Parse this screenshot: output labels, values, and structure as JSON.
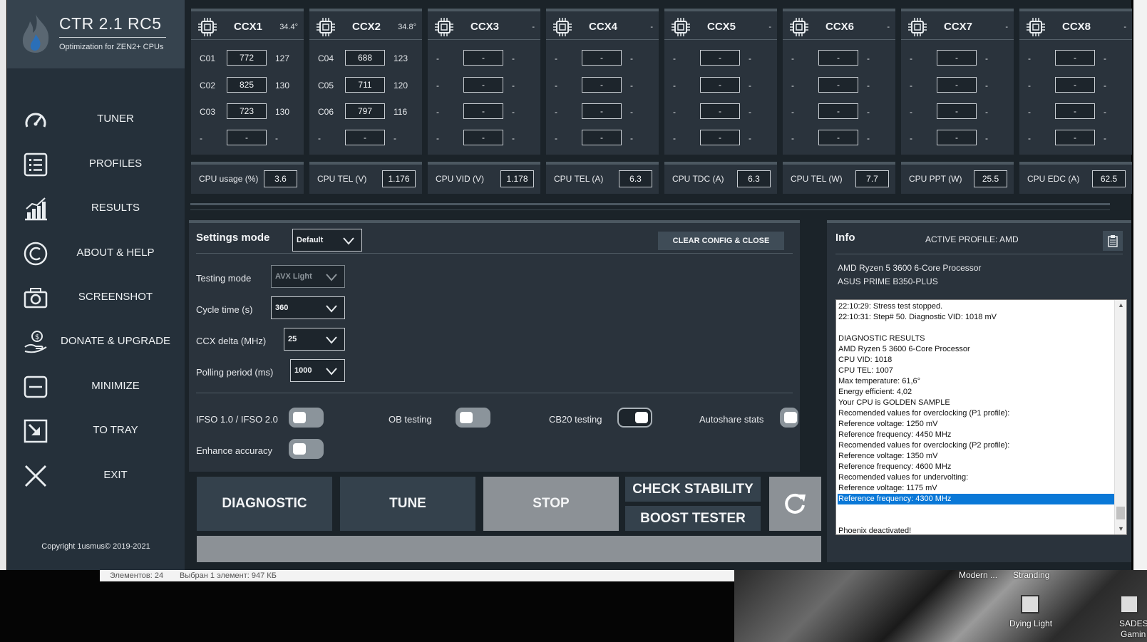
{
  "window": {
    "title": "CTR 2.1 RC5",
    "subtitle": "Optimization for ZEN2+ CPUs",
    "copyright": "Copyright 1usmus© 2019-2021"
  },
  "sidebar": {
    "items": [
      {
        "label": "TUNER",
        "icon": "gauge-icon"
      },
      {
        "label": "PROFILES",
        "icon": "list-icon"
      },
      {
        "label": "RESULTS",
        "icon": "chart-icon"
      },
      {
        "label": "ABOUT & HELP",
        "icon": "copyright-icon"
      },
      {
        "label": "SCREENSHOT",
        "icon": "camera-icon"
      },
      {
        "label": "DONATE & UPGRADE",
        "icon": "donate-hand-icon"
      },
      {
        "label": "MINIMIZE",
        "icon": "minimize-icon"
      },
      {
        "label": "TO TRAY",
        "icon": "tray-icon"
      },
      {
        "label": "EXIT",
        "icon": "close-icon"
      }
    ]
  },
  "ccx": [
    {
      "name": "CCX1",
      "temp": "34.4°",
      "cores": [
        {
          "id": "C01",
          "freq": "772",
          "val": "127"
        },
        {
          "id": "C02",
          "freq": "825",
          "val": "130"
        },
        {
          "id": "C03",
          "freq": "723",
          "val": "130"
        },
        {
          "id": "-",
          "freq": "-",
          "val": "-"
        }
      ]
    },
    {
      "name": "CCX2",
      "temp": "34.8°",
      "cores": [
        {
          "id": "C04",
          "freq": "688",
          "val": "123"
        },
        {
          "id": "C05",
          "freq": "711",
          "val": "120"
        },
        {
          "id": "C06",
          "freq": "797",
          "val": "116"
        },
        {
          "id": "-",
          "freq": "-",
          "val": "-"
        }
      ]
    },
    {
      "name": "CCX3",
      "temp": "-",
      "cores": [
        {
          "id": "-",
          "freq": "-",
          "val": "-"
        },
        {
          "id": "-",
          "freq": "-",
          "val": "-"
        },
        {
          "id": "-",
          "freq": "-",
          "val": "-"
        },
        {
          "id": "-",
          "freq": "-",
          "val": "-"
        }
      ]
    },
    {
      "name": "CCX4",
      "temp": "-",
      "cores": [
        {
          "id": "-",
          "freq": "-",
          "val": "-"
        },
        {
          "id": "-",
          "freq": "-",
          "val": "-"
        },
        {
          "id": "-",
          "freq": "-",
          "val": "-"
        },
        {
          "id": "-",
          "freq": "-",
          "val": "-"
        }
      ]
    },
    {
      "name": "CCX5",
      "temp": "-",
      "cores": [
        {
          "id": "-",
          "freq": "-",
          "val": "-"
        },
        {
          "id": "-",
          "freq": "-",
          "val": "-"
        },
        {
          "id": "-",
          "freq": "-",
          "val": "-"
        },
        {
          "id": "-",
          "freq": "-",
          "val": "-"
        }
      ]
    },
    {
      "name": "CCX6",
      "temp": "-",
      "cores": [
        {
          "id": "-",
          "freq": "-",
          "val": "-"
        },
        {
          "id": "-",
          "freq": "-",
          "val": "-"
        },
        {
          "id": "-",
          "freq": "-",
          "val": "-"
        },
        {
          "id": "-",
          "freq": "-",
          "val": "-"
        }
      ]
    },
    {
      "name": "CCX7",
      "temp": "-",
      "cores": [
        {
          "id": "-",
          "freq": "-",
          "val": "-"
        },
        {
          "id": "-",
          "freq": "-",
          "val": "-"
        },
        {
          "id": "-",
          "freq": "-",
          "val": "-"
        },
        {
          "id": "-",
          "freq": "-",
          "val": "-"
        }
      ]
    },
    {
      "name": "CCX8",
      "temp": "-",
      "cores": [
        {
          "id": "-",
          "freq": "-",
          "val": "-"
        },
        {
          "id": "-",
          "freq": "-",
          "val": "-"
        },
        {
          "id": "-",
          "freq": "-",
          "val": "-"
        },
        {
          "id": "-",
          "freq": "-",
          "val": "-"
        }
      ]
    }
  ],
  "metrics": [
    {
      "label": "CPU usage (%)",
      "value": "3.6"
    },
    {
      "label": "CPU TEL (V)",
      "value": "1.176"
    },
    {
      "label": "CPU VID (V)",
      "value": "1.178"
    },
    {
      "label": "CPU TEL (A)",
      "value": "6.3"
    },
    {
      "label": "CPU TDC (A)",
      "value": "6.3"
    },
    {
      "label": "CPU TEL (W)",
      "value": "7.7"
    },
    {
      "label": "CPU PPT (W)",
      "value": "25.5"
    },
    {
      "label": "CPU EDC (A)",
      "value": "62.5"
    }
  ],
  "settings": {
    "title": "Settings mode",
    "mode_value": "Default",
    "clear_label": "CLEAR CONFIG & CLOSE",
    "testing_mode_label": "Testing mode",
    "testing_mode_value": "AVX Light",
    "cycle_time_label": "Cycle time (s)",
    "cycle_time_value": "360",
    "ccx_delta_label": "CCX delta (MHz)",
    "ccx_delta_value": "25",
    "polling_label": "Polling period (ms)",
    "polling_value": "1000",
    "toggles": [
      {
        "label": "IFSO 1.0 / IFSO 2.0",
        "state": "off"
      },
      {
        "label": "OB testing",
        "state": "off"
      },
      {
        "label": "CB20 testing",
        "state": "on"
      },
      {
        "label": "Autoshare stats",
        "state": "off"
      },
      {
        "label": "Enhance accuracy",
        "state": "off"
      }
    ]
  },
  "actions": {
    "diagnostic": "DIAGNOSTIC",
    "tune": "TUNE",
    "stop": "STOP",
    "check_stability": "CHECK STABILITY",
    "boost_tester": "BOOST TESTER"
  },
  "info": {
    "title": "Info",
    "active_profile": "ACTIVE PROFILE: AMD",
    "cpu": "AMD Ryzen 5 3600 6-Core Processor",
    "board": "ASUS PRIME B350-PLUS",
    "log": [
      "22:10:29: Stress test stopped.",
      "22:10:31: Step# 50. Diagnostic VID: 1018 mV",
      "",
      "DIAGNOSTIC RESULTS",
      "AMD Ryzen 5 3600 6-Core Processor",
      "CPU VID: 1018",
      "CPU TEL: 1007",
      "Max temperature: 61,6°",
      "Energy efficient: 4,02",
      "Your CPU is GOLDEN SAMPLE",
      "Recomended values for overclocking (P1 profile):",
      "Reference voltage: 1250 mV",
      "Reference frequency: 4450 MHz",
      "Recomended values for overclocking (P2 profile):",
      "Reference voltage: 1350 mV",
      "Reference frequency: 4600 MHz",
      "Recomended values for undervolting:",
      "Reference voltage: 1175 mV",
      "Reference frequency: 4300 MHz",
      "",
      "",
      "Phoenix deactivated!"
    ],
    "selected_line": 18
  },
  "desktop": {
    "status_left": "Элементов: 24",
    "status_mid": "Выбран 1 элемент: 947 КБ",
    "labels": [
      "Modern ...",
      "Stranding",
      "Dying Light",
      "SADES",
      "Gamin"
    ]
  }
}
